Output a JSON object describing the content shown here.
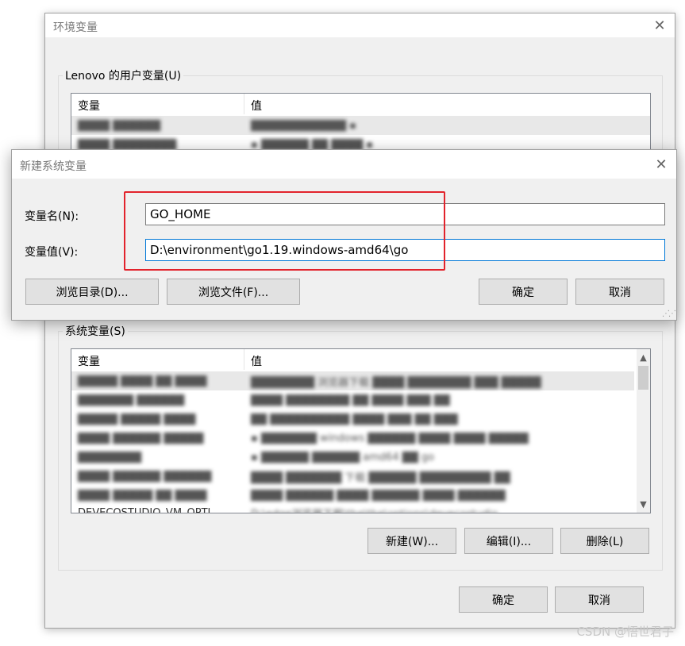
{
  "env_window": {
    "title": "环境变量",
    "user_group_label": "Lenovo 的用户变量(U)",
    "user_columns": [
      "变量",
      "值"
    ],
    "user_rows": [
      {
        "name": "████ ██████",
        "value": "████████████ ▪"
      },
      {
        "name": "████ ████████",
        "value": "▪ ██████ ██ ████ ▪"
      }
    ],
    "sys_group_label": "系统变量(S)",
    "sys_columns": [
      "变量",
      "值"
    ],
    "sys_rows": [
      {
        "name": "█████ ████ ██ ████",
        "value": "████████ 浏览器下载 ████ ████████ ███ █████"
      },
      {
        "name": "███████ ██████",
        "value": "████ ████████ ██ ████ ███ ██"
      },
      {
        "name": "█████ █████ ████",
        "value": "██ ██████████ ████ ███ ██ ███"
      },
      {
        "name": "████ ██████ █████",
        "value": "▪ ███████ windows ██████ ████ ████ █████"
      },
      {
        "name": "████████",
        "value": "▪ ██████ ██████ amd64 ██ go"
      },
      {
        "name": "████ ██████ ██████",
        "value": "████ ███████ 下载 ██████ █████████ ██"
      },
      {
        "name": "████ █████ ██ ████",
        "value": "████ ██████ ████ ██████ ████ ██████"
      },
      {
        "name": "DEVECOSTUDIO_VM_OPTI",
        "value": "D:\\edge浏览器下载\\the\\the\\options\\devecostudio"
      }
    ],
    "new_label": "新建(W)...",
    "edit_label": "编辑(I)...",
    "delete_label": "删除(L)",
    "ok_label": "确定",
    "cancel_label": "取消"
  },
  "new_dialog": {
    "title": "新建系统变量",
    "name_label": "变量名(N):",
    "name_value": "GO_HOME",
    "value_label": "变量值(V):",
    "value_value": "D:\\environment\\go1.19.windows-amd64\\go",
    "browse_dir_label": "浏览目录(D)...",
    "browse_file_label": "浏览文件(F)...",
    "ok_label": "确定",
    "cancel_label": "取消"
  },
  "icons": {
    "close": "close-icon",
    "scroll_up": "chevron-up-icon",
    "scroll_down": "chevron-down-icon",
    "resize": "resize-grip-icon"
  },
  "colors": {
    "highlight": "#e2232c",
    "focus": "#0078d7"
  },
  "watermark": "CSDN @悟世君子"
}
